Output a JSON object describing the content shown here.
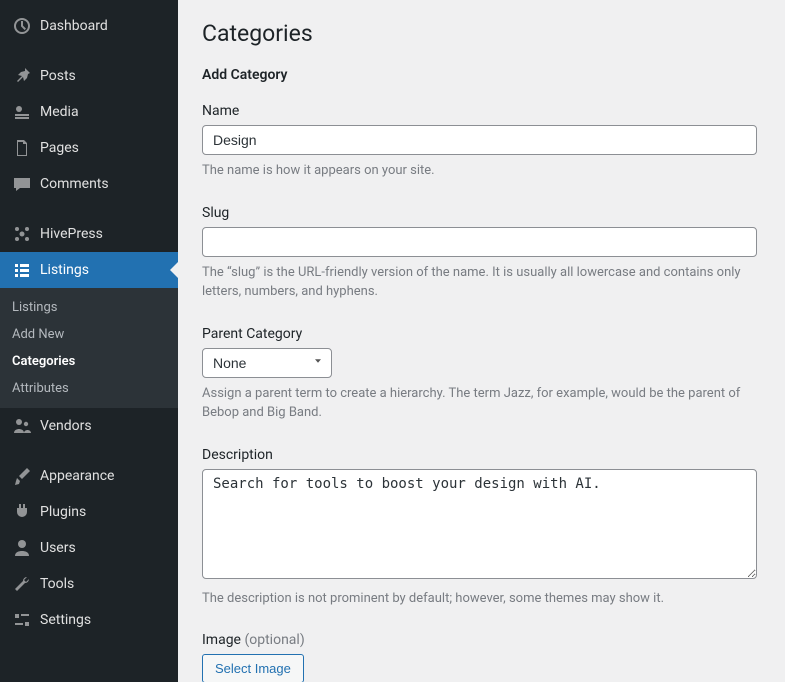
{
  "sidebar": {
    "items": [
      {
        "label": "Dashboard"
      },
      {
        "label": "Posts"
      },
      {
        "label": "Media"
      },
      {
        "label": "Pages"
      },
      {
        "label": "Comments"
      },
      {
        "label": "HivePress"
      },
      {
        "label": "Listings"
      },
      {
        "label": "Vendors"
      },
      {
        "label": "Appearance"
      },
      {
        "label": "Plugins"
      },
      {
        "label": "Users"
      },
      {
        "label": "Tools"
      },
      {
        "label": "Settings"
      }
    ],
    "submenu": [
      {
        "label": "Listings"
      },
      {
        "label": "Add New"
      },
      {
        "label": "Categories"
      },
      {
        "label": "Attributes"
      }
    ]
  },
  "main": {
    "page_title": "Categories",
    "section_title": "Add Category",
    "name": {
      "label": "Name",
      "value": "Design",
      "help": "The name is how it appears on your site."
    },
    "slug": {
      "label": "Slug",
      "value": "",
      "help": "The “slug” is the URL-friendly version of the name. It is usually all lowercase and contains only letters, numbers, and hyphens."
    },
    "parent": {
      "label": "Parent Category",
      "selected": "None",
      "help": "Assign a parent term to create a hierarchy. The term Jazz, for example, would be the parent of Bebop and Big Band."
    },
    "description": {
      "label": "Description",
      "value": "Search for tools to boost your design with AI.",
      "help": "The description is not prominent by default; however, some themes may show it."
    },
    "image": {
      "label": "Image ",
      "optional": "(optional)",
      "button": "Select Image"
    }
  }
}
